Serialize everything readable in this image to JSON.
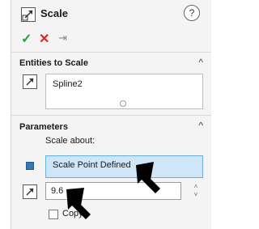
{
  "header": {
    "title": "Scale",
    "help_symbol": "?",
    "ok_symbol": "✓",
    "cancel_symbol": "✕",
    "pin_symbol": "⇥",
    "feature_icon": "scale-feature-icon"
  },
  "entities": {
    "title": "Entities to Scale",
    "caret": "^",
    "items": [
      "Spline2"
    ]
  },
  "parameters": {
    "title": "Parameters",
    "caret": "^",
    "scale_about_label": "Scale about:",
    "scale_point_value": "Scale Point Defined",
    "scale_factor_value": "9.6",
    "spin_up": "˄",
    "spin_down": "˅",
    "copy_label": "Copy",
    "copy_checked": false
  },
  "colors": {
    "ok": "#2e9e2e",
    "cancel": "#d9281e",
    "selection_highlight": "#cfe6f8",
    "selection_border": "#6aaee0",
    "bullet": "#3a78b5"
  }
}
